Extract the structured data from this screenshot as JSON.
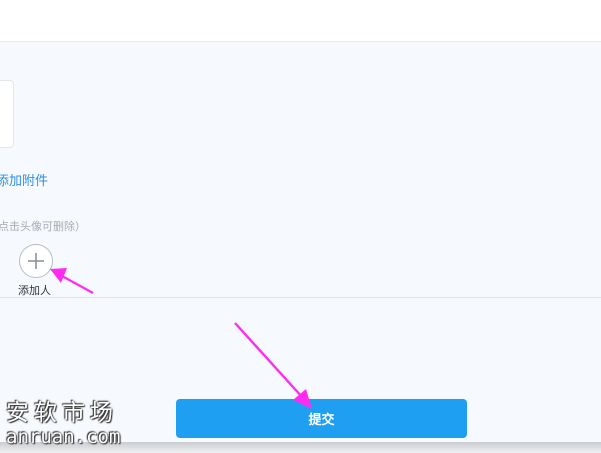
{
  "attachments": {
    "add_label": "添加附件"
  },
  "participants": {
    "hint": "点击头像可删除）",
    "add_label": "添加人"
  },
  "form": {
    "submit_label": "提交"
  },
  "watermark": {
    "cn": "安软市场",
    "en": "anruan.com"
  },
  "colors": {
    "accent": "#1e9ff2",
    "link": "#2f8fe0",
    "annotation_arrow": "#ff2cf0",
    "panel_bg": "#f6f9fd"
  },
  "icons": {
    "add_person": "plus-icon",
    "annotation": "arrow-icon"
  }
}
